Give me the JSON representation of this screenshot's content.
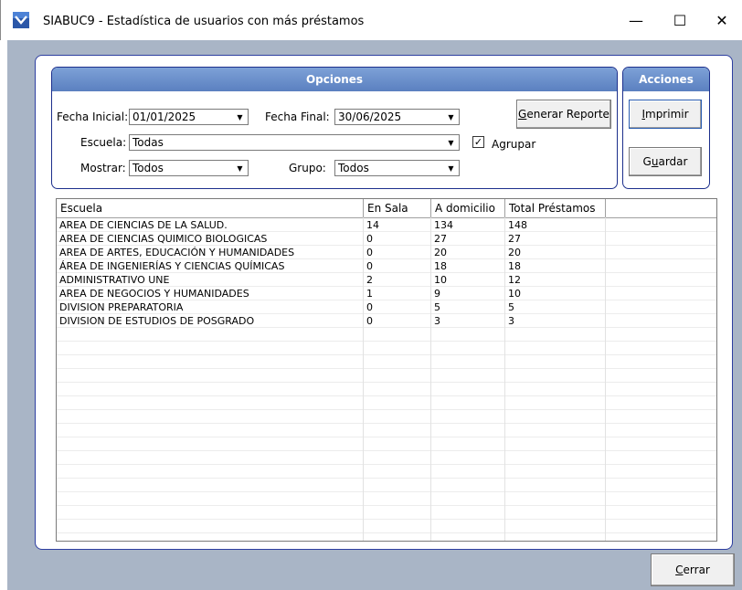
{
  "window": {
    "title": "SIABUC9 - Estadística de usuarios con más préstamos",
    "minimize_glyph": "—",
    "maximize_glyph": "☐",
    "close_glyph": "✕"
  },
  "opciones": {
    "header": "Opciones",
    "fecha_inicial_label": "Fecha Inicial:",
    "fecha_inicial_value": "01/01/2025",
    "fecha_final_label": "Fecha Final:",
    "fecha_final_value": "30/06/2025",
    "escuela_label": "Escuela:",
    "escuela_value": "Todas",
    "mostrar_label": "Mostrar:",
    "mostrar_value": "Todos",
    "grupo_label": "Grupo:",
    "grupo_value": "Todos",
    "agrupar_label": "Agrupar",
    "agrupar_checked": true,
    "generar_reporte_label": "Generar Reporte"
  },
  "acciones": {
    "header": "Acciones",
    "imprimir_label": "Imprimir",
    "guardar_label": "Guardar"
  },
  "table": {
    "columns": [
      "Escuela",
      "En Sala",
      "A domicilio",
      "Total Préstamos"
    ],
    "rows": [
      [
        "AREA DE CIENCIAS DE LA SALUD.",
        "14",
        "134",
        "148"
      ],
      [
        "AREA DE CIENCIAS QUIMICO BIOLOGICAS",
        "0",
        "27",
        "27"
      ],
      [
        "AREA DE ARTES, EDUCACIÓN Y HUMANIDADES",
        "0",
        "20",
        "20"
      ],
      [
        "ÁREA DE INGENIERÍAS Y CIENCIAS QUÍMICAS",
        "0",
        "18",
        "18"
      ],
      [
        "ADMINISTRATIVO UNE",
        "2",
        "10",
        "12"
      ],
      [
        "AREA DE NEGOCIOS Y HUMANIDADES",
        "1",
        "9",
        "10"
      ],
      [
        "DIVISION PREPARATORIA",
        "0",
        "5",
        "5"
      ],
      [
        "DIVISION DE ESTUDIOS DE POSGRADO",
        "0",
        "3",
        "3"
      ]
    ]
  },
  "footer": {
    "cerrar_label": "Cerrar"
  },
  "colors": {
    "client_bg": "#a9b5c6",
    "panel_border": "#2d3ea0",
    "header_blue": "#5b80c0"
  }
}
